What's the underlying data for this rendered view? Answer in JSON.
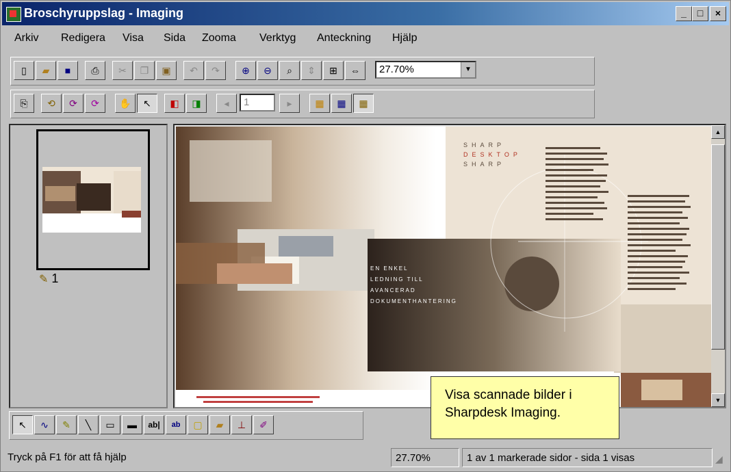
{
  "window": {
    "title": "Broschyruppslag - Imaging",
    "controls": [
      "_",
      "□",
      "×"
    ]
  },
  "menu": [
    "Arkiv",
    "Redigera",
    "Visa",
    "Sida",
    "Zooma",
    "Verktyg",
    "Anteckning",
    "Hjälp"
  ],
  "toolbar": {
    "zoom_value": "27.70%"
  },
  "toolbar2": {
    "page_number": "1"
  },
  "thumbnail": {
    "page_label": "1"
  },
  "document": {
    "overlay_text": [
      "EN ENKEL",
      "LEDNING TILL",
      "AVANCERAD",
      "DOKUMENTHANTERING"
    ],
    "header_words": [
      "SHARP",
      "DESKTOP",
      "SHARP"
    ]
  },
  "callout": {
    "line1": "Visa scannade bilder i",
    "line2": "Sharpdesk  Imaging."
  },
  "status": {
    "help": "Tryck på F1 för att få hjälp",
    "zoom": "27.70%",
    "pages": "1 av 1 markerade sidor - sida 1 visas"
  }
}
